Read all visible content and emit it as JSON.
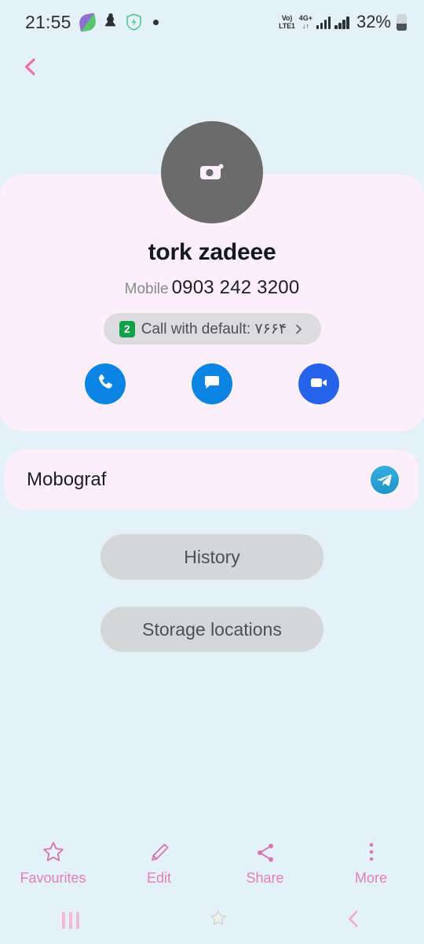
{
  "status_bar": {
    "time": "21:55",
    "icons_left": [
      "leaf-icon",
      "silhouette-icon",
      "shield-bolt-icon",
      "dot-icon"
    ],
    "volte_line1": "Vo)",
    "volte_line2": "LTE1",
    "network_type": "4G+",
    "network_arrows": "↓↑",
    "signal_icons": [
      "signal-bars-icon",
      "signal-bars-icon"
    ],
    "battery_percent": "32%",
    "battery_icon": "battery-icon"
  },
  "nav_back": {
    "icon": "back-chevron-icon"
  },
  "profile": {
    "avatar_icon": "camera-icon",
    "name": "tork zadeee",
    "phone_label": "Mobile",
    "phone_number": "0903 242 3200",
    "default_chip": {
      "sim_badge": "2",
      "text": "Call with default: ۷۶۶۴",
      "chevron": "chevron-right-icon"
    },
    "actions": [
      {
        "name": "call-button",
        "icon": "phone-icon",
        "color": "#0c84e4"
      },
      {
        "name": "message-button",
        "icon": "message-icon",
        "color": "#0c84e4"
      },
      {
        "name": "video-call-button",
        "icon": "video-camera-icon",
        "color": "#2563eb"
      }
    ]
  },
  "app_row": {
    "label": "Mobograf",
    "icon": "telegram-icon"
  },
  "pills": {
    "history": "History",
    "storage": "Storage locations"
  },
  "toolbar": {
    "items": [
      {
        "label": "Favourites",
        "icon": "star-icon"
      },
      {
        "label": "Edit",
        "icon": "pencil-icon"
      },
      {
        "label": "Share",
        "icon": "share-icon"
      },
      {
        "label": "More",
        "icon": "more-vertical-icon"
      }
    ]
  },
  "navbar": {
    "recents": "recents-icon",
    "home": "moon-star-home-icon",
    "back": "back-chevron-icon"
  },
  "colors": {
    "background": "#e4f1f8",
    "card": "#fdf0fa",
    "accent_pink": "#e07fbb",
    "blue": "#0c84e4",
    "video_blue": "#2563eb",
    "green_badge": "#12a04a",
    "pill_gray": "#d4d6d8"
  }
}
